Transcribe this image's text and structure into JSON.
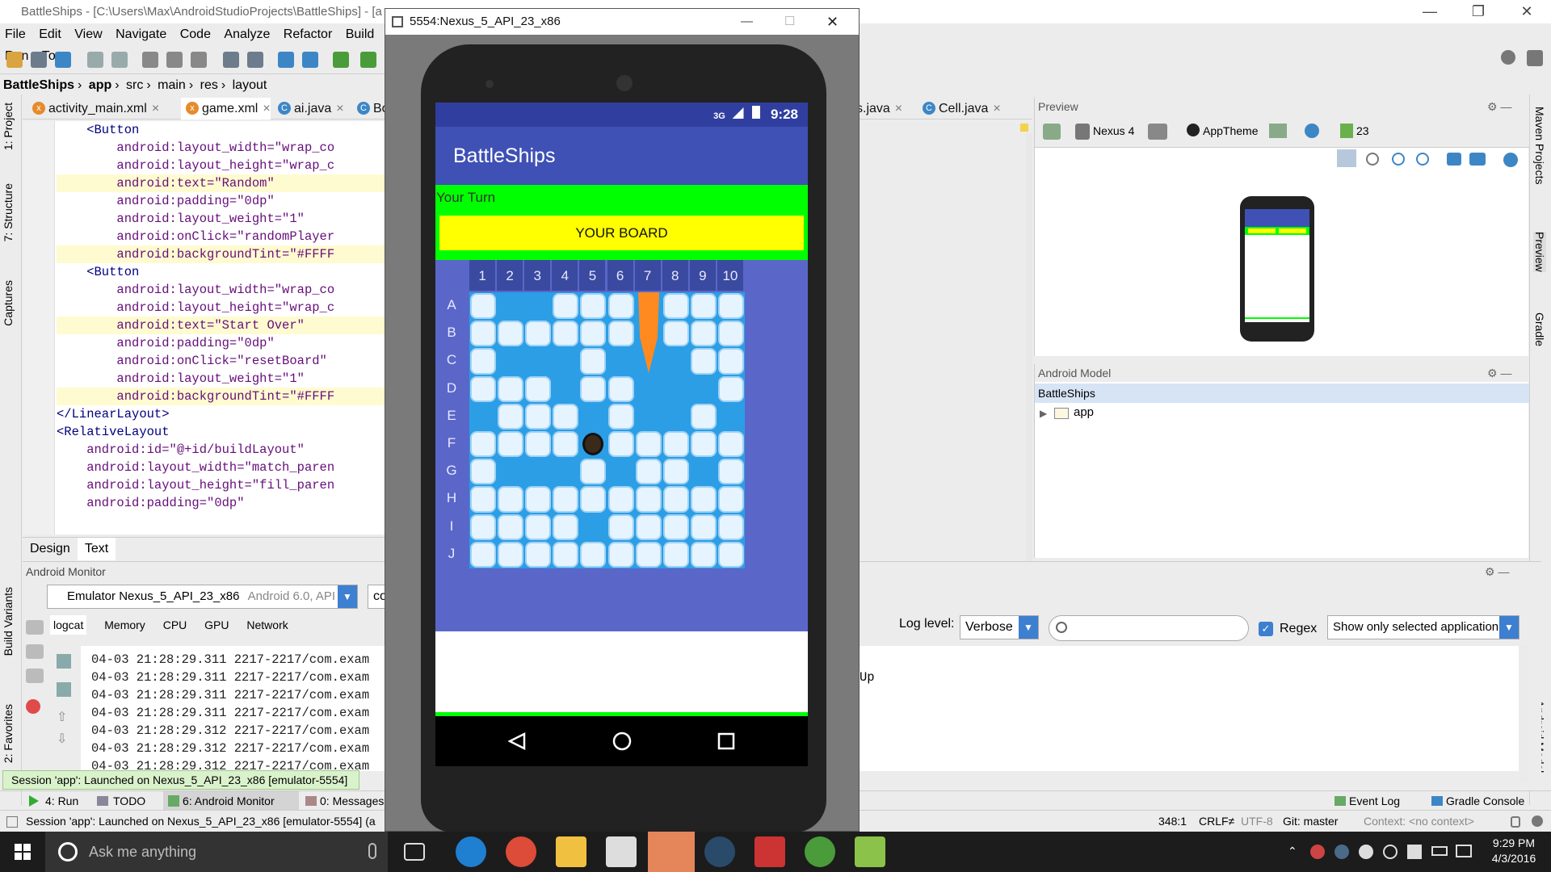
{
  "ide": {
    "title": "BattleShips - [C:\\Users\\Max\\AndroidStudioProjects\\BattleShips] - [a",
    "menu": [
      "File",
      "Edit",
      "View",
      "Navigate",
      "Code",
      "Analyze",
      "Refactor",
      "Build",
      "Run",
      "To"
    ],
    "breadcrumb": [
      "BattleShips",
      "app",
      "src",
      "main",
      "res",
      "layout"
    ],
    "editor_tabs": [
      "activity_main.xml",
      "game.xml",
      "ai.java",
      "Bo",
      "s.java",
      "Cell.java"
    ],
    "left_tabs": [
      "1: Project",
      "7: Structure",
      "Captures",
      "Build Variants",
      "2: Favorites"
    ],
    "right_tabs": [
      "Maven Projects",
      "Preview",
      "Gradle",
      "Android Model"
    ],
    "code_lines": [
      "    <Button",
      "        android:layout_width=\"wrap_co",
      "        android:layout_height=\"wrap_c",
      "        android:text=\"Random\"",
      "        android:padding=\"0dp\"",
      "        android:layout_weight=\"1\"",
      "        android:onClick=\"randomPlayer",
      "        android:backgroundTint=\"#FFFF",
      "    <Button",
      "        android:layout_width=\"wrap_co",
      "        android:layout_height=\"wrap_c",
      "        android:text=\"Start Over\"",
      "        android:padding=\"0dp\"",
      "        android:onClick=\"resetBoard\"",
      "        android:layout_weight=\"1\"",
      "        android:backgroundTint=\"#FFFF",
      "</LinearLayout>",
      "",
      "<RelativeLayout",
      "    android:id=\"@+id/buildLayout\"",
      "    android:layout_width=\"match_paren",
      "    android:layout_height=\"fill_paren",
      "    android:padding=\"0dp\""
    ],
    "design_tab": "Design",
    "text_tab": "Text",
    "monitor_title": "Android Monitor",
    "device_selector": "Emulator Nexus_5_API_23_x86",
    "device_detail": "Android 6.0, API 23",
    "process_selector": "co",
    "monitor_tabs": [
      "logcat",
      "Memory",
      "CPU",
      "GPU",
      "Network"
    ],
    "log_level_label": "Log level:",
    "log_level_value": "Verbose",
    "regex_label": "Regex",
    "filter_value": "Show only selected application",
    "log_lines": [
      "04-03 21:28:29.311 2217-2217/com.exam",
      "04-03 21:28:29.311 2217-2217/com.exam",
      "04-03 21:28:29.311 2217-2217/com.exam",
      "04-03 21:28:29.311 2217-2217/com.exam",
      "04-03 21:28:29.312 2217-2217/com.exam",
      "04-03 21:28:29.312 2217-2217/com.exam",
      "04-03 21:28:29.312 2217-2217/com.exam"
    ],
    "log_tail": "Up",
    "session_toast": "Session 'app': Launched on Nexus_5_API_23_x86 [emulator-5554]",
    "session_app": "app",
    "toolwindows": [
      "4: Run",
      "TODO",
      "6: Android Monitor",
      "0: Messages"
    ],
    "event_log": "Event Log",
    "gradle_console": "Gradle Console",
    "status_text": "Session 'app': Launched on Nexus_5_API_23_x86 [emulator-5554] (a",
    "status_right": [
      "348:1",
      "CRLF≠",
      "UTF-8",
      "Git: master",
      "Context: <no context>"
    ],
    "preview_title": "Preview",
    "preview_device": "Nexus 4",
    "preview_theme": "AppTheme",
    "preview_api": "23",
    "android_model_title": "Android Model",
    "android_model_root": "BattleShips",
    "android_model_child": "app"
  },
  "emulator": {
    "window_title": "5554:Nexus_5_API_23_x86",
    "time": "9:28",
    "signal": "3G",
    "app_title": "BattleShips",
    "turn_text": "Your Turn",
    "board_button": "YOUR BOARD",
    "cols": [
      "1",
      "2",
      "3",
      "4",
      "5",
      "6",
      "7",
      "8",
      "9",
      "10"
    ],
    "rows": [
      "A",
      "B",
      "C",
      "D",
      "E",
      "F",
      "G",
      "H",
      "I",
      "J"
    ],
    "ice_cells": [
      [
        1,
        0,
        0,
        1,
        1,
        1,
        0,
        1,
        1,
        1
      ],
      [
        1,
        1,
        1,
        1,
        1,
        1,
        0,
        1,
        1,
        1
      ],
      [
        1,
        0,
        0,
        0,
        1,
        0,
        0,
        0,
        1,
        1
      ],
      [
        1,
        1,
        1,
        0,
        1,
        1,
        0,
        0,
        0,
        1
      ],
      [
        0,
        1,
        1,
        1,
        0,
        1,
        0,
        0,
        1,
        0
      ],
      [
        1,
        1,
        1,
        1,
        0,
        1,
        1,
        1,
        1,
        1
      ],
      [
        1,
        0,
        0,
        0,
        1,
        0,
        1,
        1,
        0,
        1
      ],
      [
        1,
        1,
        1,
        1,
        1,
        1,
        1,
        1,
        1,
        1
      ],
      [
        1,
        1,
        1,
        1,
        0,
        1,
        1,
        1,
        1,
        1
      ],
      [
        1,
        1,
        1,
        1,
        1,
        1,
        1,
        1,
        1,
        1
      ]
    ],
    "ship_column": "7",
    "ship_rows": [
      "A",
      "B",
      "C"
    ],
    "hit_cell": "F5"
  },
  "taskbar": {
    "search_placeholder": "Ask me anything",
    "time": "9:29 PM",
    "date": "4/3/2016"
  },
  "colors": {
    "app_bar": "#3f51b5",
    "status_bar": "#303f9f",
    "board_button": "#ffff00",
    "turn_bg": "#00ff00",
    "water": "#2b9ee6",
    "ship": "#ff8a20"
  }
}
